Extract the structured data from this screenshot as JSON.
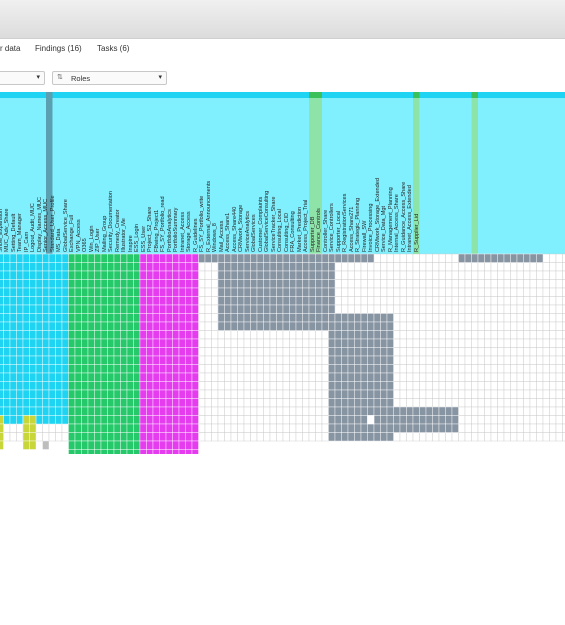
{
  "tabs": [
    "r data",
    "Findings (16)",
    "Tasks (6)"
  ],
  "filters": [
    {
      "label": "",
      "caret": "▾"
    },
    {
      "label": "Roles",
      "icon": "sort-icon",
      "caret": "▾"
    }
  ],
  "colors": {
    "cyan": "#1fd3f2",
    "cyan_header": "#80f0ff",
    "green": "#26c96a",
    "magenta": "#e63cf0",
    "gray": "#8795a3",
    "yellow": "#c8d63a",
    "highlight_header": "#8de3a8",
    "highlight_top": "#3cc15a",
    "dark_col": "#5aa0b0"
  },
  "columns": [
    "Show_Expansion",
    "MUC_Adv_Share",
    "Setting_Default",
    "Team_Manager",
    "IP_Cam",
    "Logout_Audit_MUC",
    "Display_Names_MUC",
    "Senior_Access_MUC",
    "Standard_User_Profile",
    "MS_Data",
    "GlobalService_Share",
    "Exchange_Full",
    "VPN_Access",
    "O365",
    "Win_Login",
    "ZIP_User",
    "Mailing_Group",
    "Security_Documentation",
    "Remedy_Creator",
    "Illustrator_Me",
    "Inspire",
    "ESS_Login",
    "ESS_User",
    "Project_S2_Share",
    "FBwing_Project1",
    "FS_SY_Portfolio_read",
    "PortfolioAnalytics",
    "PortfolioSummary",
    "Intranet_Access",
    "Storage_Access",
    "R_Guidelines",
    "FS_SY_Portfolio_write",
    "R_External_Announcements",
    "Windows_8",
    "Mail_Access",
    "Access_Share1",
    "Access_Share440",
    "CRMwork_Storage",
    "ServiceAnalytics",
    "GlobalServices",
    "Customer_Complaints",
    "GlobalServiceConsulting",
    "ServiceTracker_Share",
    "Consulting_Local",
    "Consulting_CID",
    "FRA_Consulting",
    "Market_Prediction",
    "Access_Project_Trial",
    "Supporter_DB",
    "Finance_Controls",
    "Controller_Share",
    "Service_Controllers",
    "Supporter_Local",
    "R_RegistrationServices",
    "Access_Share271",
    "R_Strategic_Planning",
    "Firewall_SW",
    "Invoice_Processing",
    "CRMwork_Storage_Extended",
    "Service_Data_Mgt",
    "R_Management_Planning",
    "Internal_Access_Share",
    "R_Guidance_Access_Share",
    "Intranet_Access_Extended",
    "R_Supplier_Lid"
  ]
}
